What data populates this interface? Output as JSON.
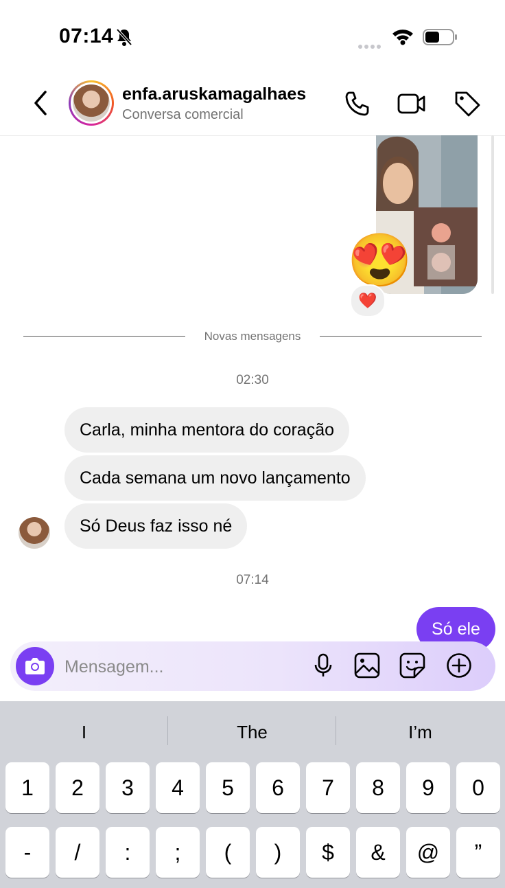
{
  "status_bar": {
    "time": "07:14"
  },
  "header": {
    "username": "enfa.aruskamagalhaes",
    "subtitle": "Conversa comercial"
  },
  "shared_post": {
    "big_emoji": "😍",
    "reaction": "❤️"
  },
  "divider": {
    "label": "Novas mensagens"
  },
  "timestamps": [
    "02:30",
    "07:14"
  ],
  "messages_received": [
    "Carla, minha mentora do coração",
    "Cada semana um novo lançamento",
    "Só Deus faz isso né"
  ],
  "messages_sent": [
    "Só ele"
  ],
  "composer": {
    "placeholder": "Mensagem..."
  },
  "keyboard": {
    "suggestions": [
      "I",
      "The",
      "I’m"
    ],
    "row1": [
      "1",
      "2",
      "3",
      "4",
      "5",
      "6",
      "7",
      "8",
      "9",
      "0"
    ],
    "row2": [
      "-",
      "/",
      ":",
      ";",
      "(",
      ")",
      "$",
      "&",
      "@",
      "”"
    ]
  },
  "colors": {
    "accent": "#7a3ff2",
    "bubble_received": "#efefef",
    "keyboard_bg": "#d1d3d9"
  }
}
